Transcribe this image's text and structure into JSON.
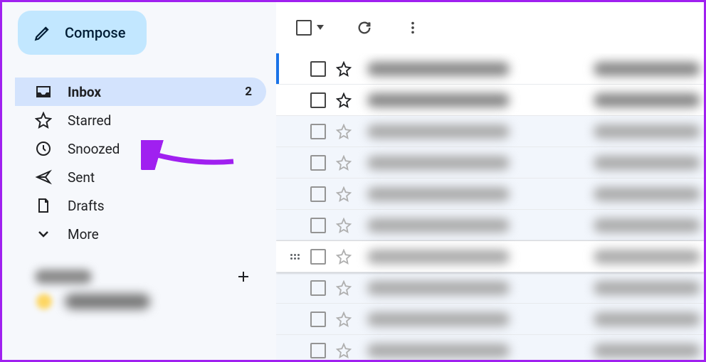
{
  "compose": {
    "label": "Compose"
  },
  "sidebar": {
    "items": [
      {
        "label": "Inbox",
        "icon": "inbox-icon",
        "count": "2",
        "active": true
      },
      {
        "label": "Starred",
        "icon": "star-icon"
      },
      {
        "label": "Snoozed",
        "icon": "clock-icon"
      },
      {
        "label": "Sent",
        "icon": "send-icon"
      },
      {
        "label": "Drafts",
        "icon": "file-icon"
      },
      {
        "label": "More",
        "icon": "chevron-down-icon"
      }
    ]
  },
  "labels_heading": "Labels",
  "annotation": {
    "arrow_target": "Snoozed",
    "arrow_color": "#a020f0"
  },
  "toolbar": {
    "select_all": "Select",
    "refresh": "Refresh",
    "more": "More"
  },
  "emails": [
    {
      "state": "unread",
      "selected": true
    },
    {
      "state": "unread"
    },
    {
      "state": "read"
    },
    {
      "state": "read"
    },
    {
      "state": "read"
    },
    {
      "state": "read"
    },
    {
      "state": "read",
      "hover": true
    },
    {
      "state": "read"
    },
    {
      "state": "read"
    },
    {
      "state": "read"
    }
  ]
}
